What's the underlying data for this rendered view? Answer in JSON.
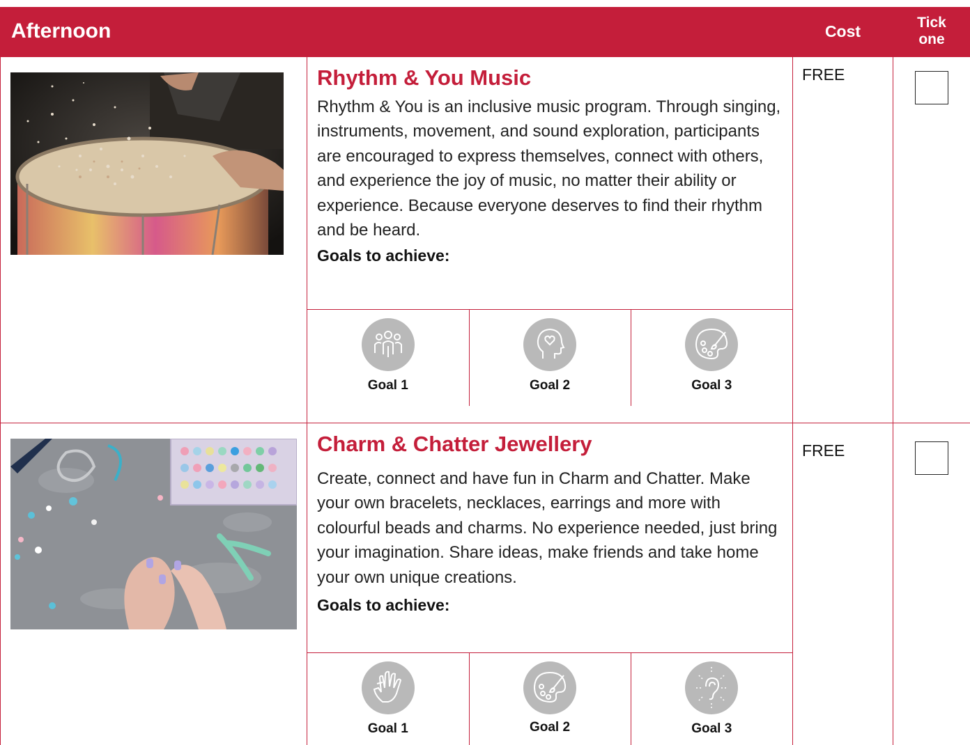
{
  "header": {
    "title": "Afternoon",
    "cost_label": "Cost",
    "tick_line1": "Tick",
    "tick_line2": "one"
  },
  "activities": [
    {
      "title": "Rhythm & You Music",
      "description": "Rhythm & You is an inclusive music program. Through singing, instruments, movement, and sound exploration, participants are encouraged to express themselves, connect with others, and experience the joy of music, no matter their ability or experience. Because everyone deserves to find their rhythm and be heard.",
      "goals_label": "Goals to achieve:",
      "cost": "FREE",
      "goals": [
        {
          "label": "Goal 1",
          "icon": "people-group-icon"
        },
        {
          "label": "Goal 2",
          "icon": "head-heart-icon"
        },
        {
          "label": "Goal 3",
          "icon": "paint-palette-icon"
        }
      ]
    },
    {
      "title": "Charm & Chatter Jewellery",
      "description": "Create, connect and have fun in Charm and Chatter. Make your own bracelets, necklaces, earrings and more with colourful beads and charms. No experience needed, just bring your imagination. Share ideas, make friends and take home your own unique creations.",
      "goals_label": "Goals to achieve:",
      "cost": "FREE",
      "goals": [
        {
          "label": "Goal 1",
          "icon": "hand-icon"
        },
        {
          "label": "Goal 2",
          "icon": "paint-palette-icon"
        },
        {
          "label": "Goal 3",
          "icon": "ear-sound-icon"
        }
      ]
    }
  ],
  "colors": {
    "brand": "#c41e3a",
    "icon_bg": "#b9b9b9"
  }
}
